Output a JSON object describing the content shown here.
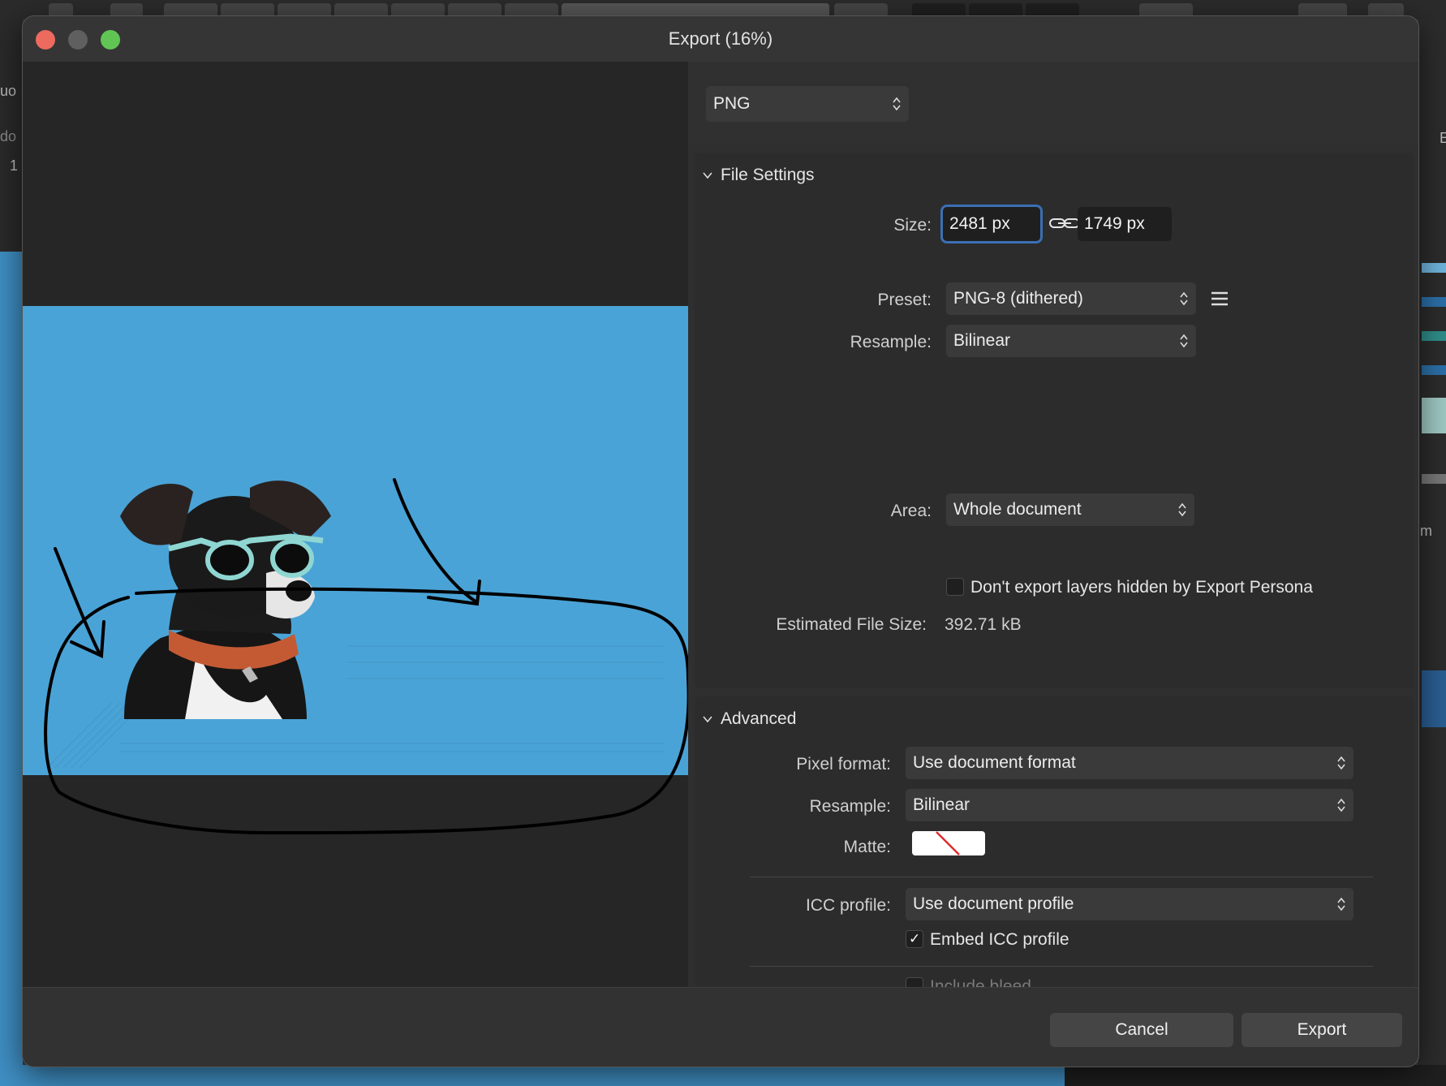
{
  "window": {
    "title": "Export (16%)"
  },
  "background_app": {
    "left_text_1": "uo",
    "left_text_2": "do",
    "left_text_3": "1",
    "right_text_1": "E",
    "right_text_2": "m"
  },
  "format": {
    "selected": "PNG"
  },
  "file_settings": {
    "heading": "File Settings",
    "size_label": "Size:",
    "width_value": "2481 px",
    "height_value": "1749 px",
    "preset_label": "Preset:",
    "preset_value": "PNG-8 (dithered)",
    "resample_label": "Resample:",
    "resample_value": "Bilinear",
    "area_label": "Area:",
    "area_value": "Whole document",
    "hidden_layers_label": "Don't export layers hidden by Export Persona",
    "hidden_layers_checked": false,
    "estimated_size_label": "Estimated File Size:",
    "estimated_size_value": "392.71 kB"
  },
  "advanced": {
    "heading": "Advanced",
    "pixel_format_label": "Pixel format:",
    "pixel_format_value": "Use document format",
    "resample_label": "Resample:",
    "resample_value": "Bilinear",
    "matte_label": "Matte:",
    "icc_label": "ICC profile:",
    "icc_value": "Use document profile",
    "embed_icc_label": "Embed ICC profile",
    "embed_icc_checked": true,
    "include_bleed_label": "Include bleed",
    "include_bleed_checked": false
  },
  "buttons": {
    "cancel": "Cancel",
    "export": "Export"
  },
  "colors": {
    "canvas_blue": "#4aa3d6",
    "accent": "#3b6fb4",
    "close": "#ed6a5e",
    "minimize": "#5f5f5f",
    "zoom": "#61c554"
  }
}
